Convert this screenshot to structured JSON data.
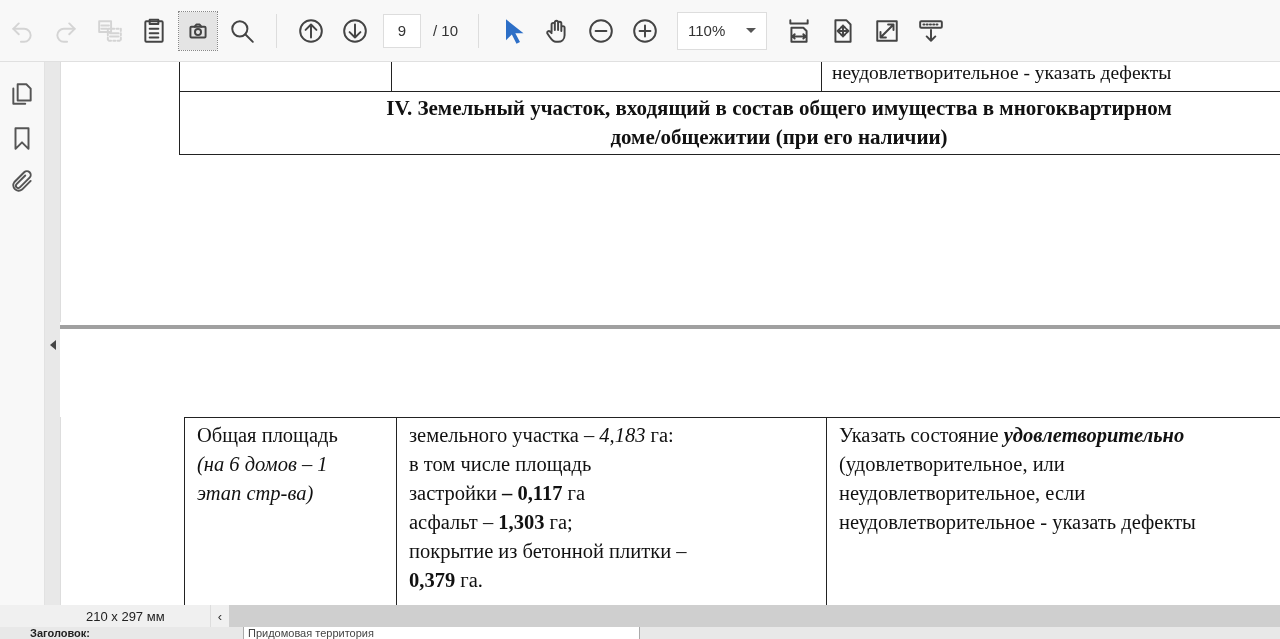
{
  "toolbar": {
    "tools": [
      {
        "kind": "undo",
        "disabled": true
      },
      {
        "kind": "redo",
        "disabled": true
      },
      {
        "kind": "compare",
        "disabled": true
      },
      {
        "kind": "clipboard"
      },
      {
        "kind": "snapshot",
        "selected": true
      },
      {
        "kind": "search"
      },
      {
        "kind": "separator"
      },
      {
        "kind": "prev-page"
      },
      {
        "kind": "next-page"
      },
      {
        "kind": "page-field"
      },
      {
        "kind": "separator"
      },
      {
        "kind": "select"
      },
      {
        "kind": "hand"
      },
      {
        "kind": "zoom-out"
      },
      {
        "kind": "zoom-in"
      },
      {
        "kind": "zoom-field"
      },
      {
        "kind": "fit-width"
      },
      {
        "kind": "fit-page"
      },
      {
        "kind": "full-screen"
      },
      {
        "kind": "scroll-mode"
      }
    ],
    "page_number": "9",
    "page_count": "/ 10",
    "zoom": "110%"
  },
  "sidebar": {
    "items": [
      {
        "kind": "pages"
      },
      {
        "kind": "bookmark"
      },
      {
        "kind": "attachment"
      }
    ]
  },
  "pages": [
    {
      "kind": "section",
      "top_row_cells": [
        "",
        "",
        "неудовлетворительное - указать дефекты"
      ],
      "heading": [
        "IV. Земельный участок, входящий в состав общего имущества в многоквартирном",
        "доме/общежитии (при его наличии)"
      ]
    },
    {
      "kind": "table",
      "row": [
        {
          "lines": [
            "Общая площадь"
          ],
          "note_lines": [
            "(на 6 домов – 1",
            "этап стр-ва)"
          ]
        },
        {
          "lines": [
            "земельного участка – *4,183* га:",
            "в том числе площадь",
            "застройки **– 0,117** га",
            "асфальт – **1,303** га;",
            "покрытие из бетонной плитки –",
            "**0,379** га."
          ]
        },
        {
          "lines": [
            "Указать состояние **удовлетворительно**",
            "(удовлетворительное, или",
            "неудовлетворительное, если",
            "неудовлетворительное - указать дефекты"
          ]
        }
      ]
    }
  ],
  "status_bar": {
    "page_size": "210 x 297 мм",
    "scroll_left": "‹"
  },
  "form_strip": {
    "label": "Заголовок:",
    "value": "Придомовая территория"
  }
}
